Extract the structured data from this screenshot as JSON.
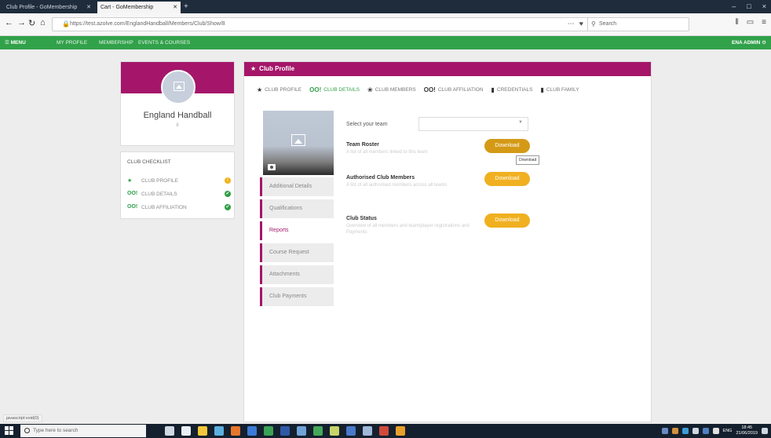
{
  "browser": {
    "tabs": [
      {
        "label": "Club Profile - GoMembership"
      },
      {
        "label": "Cart - GoMembership"
      }
    ],
    "new_tab": "+",
    "url": "https://test.azolve.com/EnglandHandball/Members/Club/Show/8",
    "search_placeholder": "Search",
    "window_controls": [
      "–",
      "□",
      "×"
    ]
  },
  "appbar": {
    "menu": "MENU",
    "nav": [
      "MY PROFILE",
      "MEMBERSHIP",
      "EVENTS & COURSES"
    ],
    "user": "ENA ADMIN"
  },
  "profile": {
    "club_name": "England Handball",
    "club_sub": "8"
  },
  "checklist": {
    "title": "CLUB CHECKLIST",
    "items": [
      {
        "label": "CLUB PROFILE",
        "icon": "★",
        "status": "!"
      },
      {
        "label": "CLUB DETAILS",
        "icon": "oo!",
        "status": "✔"
      },
      {
        "label": "CLUB AFFILIATION",
        "icon": "oo!",
        "status": "✔"
      }
    ]
  },
  "panel": {
    "title": "Club Profile",
    "tabs": [
      {
        "label": "CLUB PROFILE",
        "icon": "★"
      },
      {
        "label": "CLUB DETAILS",
        "icon": "oo!"
      },
      {
        "label": "CLUB MEMBERS",
        "icon": "❀"
      },
      {
        "label": "CLUB AFFILIATION",
        "icon": "oo!"
      },
      {
        "label": "CREDENTIALS",
        "icon": "▮"
      },
      {
        "label": "CLUB FAMILY",
        "icon": "▮"
      }
    ],
    "side_menu": [
      "Additional Details",
      "Qualifications",
      "Reports",
      "Course Request",
      "Attachments",
      "Club Payments"
    ],
    "active_side": "Reports",
    "team_label": "Select your team",
    "team_select_value": "",
    "reports": [
      {
        "title": "Team Roster",
        "desc": "A list of all members linked to this team",
        "button": "Download"
      },
      {
        "title": "Authorised Club Members",
        "desc": "A list of all authorised members across all teams",
        "button": "Download"
      },
      {
        "title": "Club Status",
        "desc": "Overview of all members and team/player registrations and Payments",
        "button": "Download"
      }
    ],
    "tooltip": "Download"
  },
  "status_url": "javascript:void(0)",
  "taskbar": {
    "search_placeholder": "Type here to search",
    "lang": "ENG",
    "time": "18:45",
    "date": "21/06/2019"
  },
  "colors": {
    "green": "#31a14a",
    "magenta": "#a5166a",
    "download": "#f0b020",
    "warn": "#f2b21d"
  }
}
